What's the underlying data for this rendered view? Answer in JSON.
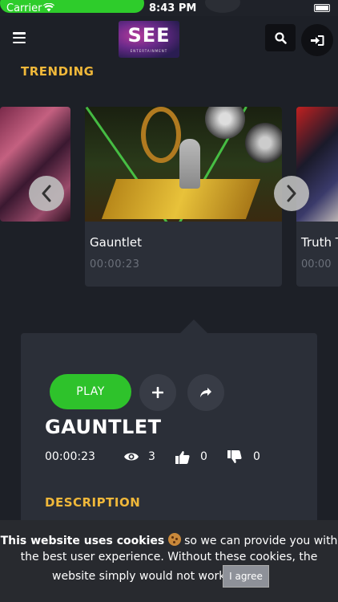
{
  "status_bar": {
    "carrier": "Carrier",
    "time": "8:43 PM"
  },
  "header": {
    "logo_text": "SEE",
    "logo_subtext": "ENTERTAINMENT",
    "icons": [
      "menu-icon",
      "search-icon",
      "sign-in-icon"
    ]
  },
  "trending": {
    "section_title": "TRENDING",
    "cards": [
      {
        "title": "",
        "duration": ""
      },
      {
        "title": "Gauntlet",
        "duration": "00:00:23"
      },
      {
        "title": "Truth T",
        "duration": "00:00"
      }
    ]
  },
  "detail": {
    "play_label": "PLAY",
    "title": "GAUNTLET",
    "duration": "00:00:23",
    "views": "3",
    "likes": "0",
    "dislikes": "0",
    "description_title": "DESCRIPTION",
    "accent_color": "#2ec22b",
    "heading_color": "#f0b83a"
  },
  "cookie_banner": {
    "bold_text": "This website uses cookies",
    "text_after_emoji": "so we can provide you with",
    "line2": "the best user experience. Without these cookies, the",
    "line3": "website simply would not work.",
    "agree_label": "I agree"
  }
}
